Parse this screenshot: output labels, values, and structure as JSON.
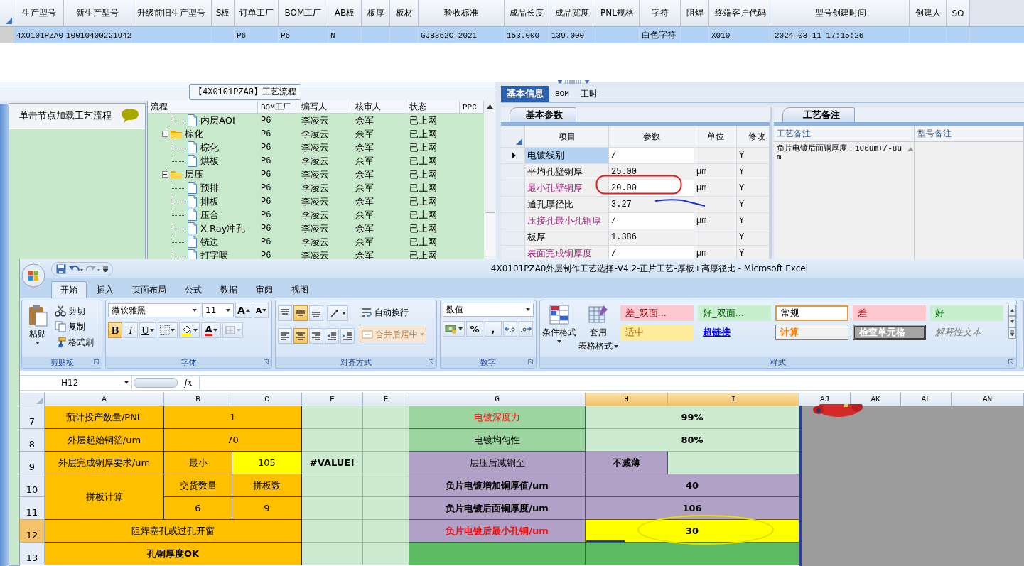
{
  "product_table": {
    "columns": [
      "生产型号",
      "新生产型号",
      "升级前旧生产型号",
      "S板",
      "订单工厂",
      "BOM工厂",
      "AB板",
      "板厚",
      "板材",
      "验收标准",
      "成品长度",
      "成品宽度",
      "PNL规格",
      "字符",
      "阻焊",
      "终端客户代码",
      "型号创建时间",
      "创建人",
      "SO"
    ],
    "rows": [
      {
        "selected": true,
        "cells": [
          "4X0101PZA0",
          "10010400221942",
          "",
          "",
          "P6",
          "P6",
          "N",
          "",
          "",
          "GJB362C-2021",
          "153.000",
          "139.000",
          "",
          "白色字符",
          "",
          "X010",
          "2024-03-11 17:15:26",
          "",
          ""
        ]
      }
    ]
  },
  "process_panel": {
    "title": "【4X0101PZA0】工艺流程",
    "hint": "单击节点加载工艺流程",
    "tree": {
      "columns": [
        "流程",
        "BOM工厂",
        "编写人",
        "核审人",
        "状态",
        "PPC"
      ],
      "continued_children": [
        {
          "kind": "file",
          "name": "内层AOI",
          "bom_factory": "P6",
          "author": "李凌云",
          "reviewer": "佘军",
          "status": "已上网"
        }
      ],
      "items": [
        {
          "kind": "folder",
          "name": "棕化",
          "expanded": true,
          "bom_factory": "P6",
          "author": "李凌云",
          "reviewer": "佘军",
          "status": "已上网",
          "children": [
            {
              "kind": "file",
              "name": "棕化",
              "bom_factory": "P6",
              "author": "李凌云",
              "reviewer": "佘军",
              "status": "已上网"
            },
            {
              "kind": "file",
              "name": "烘板",
              "bom_factory": "P6",
              "author": "李凌云",
              "reviewer": "佘军",
              "status": "已上网"
            }
          ]
        },
        {
          "kind": "folder",
          "name": "层压",
          "expanded": true,
          "bom_factory": "P6",
          "author": "李凌云",
          "reviewer": "佘军",
          "status": "已上网",
          "children": [
            {
              "kind": "file",
              "name": "预排",
              "bom_factory": "P6",
              "author": "李凌云",
              "reviewer": "佘军",
              "status": "已上网"
            },
            {
              "kind": "file",
              "name": "排板",
              "bom_factory": "P6",
              "author": "李凌云",
              "reviewer": "佘军",
              "status": "已上网"
            },
            {
              "kind": "file",
              "name": "压合",
              "bom_factory": "P6",
              "author": "李凌云",
              "reviewer": "佘军",
              "status": "已上网"
            },
            {
              "kind": "file",
              "name": "X-Ray冲孔",
              "bom_factory": "P6",
              "author": "李凌云",
              "reviewer": "佘军",
              "status": "已上网"
            },
            {
              "kind": "file",
              "name": "铣边",
              "bom_factory": "P6",
              "author": "李凌云",
              "reviewer": "佘军",
              "status": "已上网"
            },
            {
              "kind": "file",
              "name": "打字唛",
              "bom_factory": "P6",
              "author": "李凌云",
              "reviewer": "佘军",
              "status": "已上网"
            }
          ]
        }
      ]
    }
  },
  "detail_panel": {
    "tabs": [
      {
        "label": "基本信息",
        "selected": true
      },
      {
        "label": "BOM",
        "selected": false
      },
      {
        "label": "工时",
        "selected": false
      }
    ],
    "params": {
      "tab": "基本参数",
      "columns": [
        "项目",
        "参数",
        "单位",
        "修改"
      ],
      "rows": [
        {
          "item": "电镀线别",
          "value": "/",
          "modifiable": "Y",
          "required": false,
          "current": true
        },
        {
          "item": "平均孔壁铜厚",
          "value": "25.00",
          "unit": "µm",
          "modifiable": "Y",
          "required": false,
          "current": false
        },
        {
          "item": "最小孔壁铜厚",
          "value": "20.00",
          "unit": "µm",
          "modifiable": "Y",
          "required": true,
          "current": false
        },
        {
          "item": "通孔厚径比",
          "value": "3.27",
          "modifiable": "Y",
          "required": false,
          "current": false
        },
        {
          "item": "压接孔最小孔铜厚",
          "value": "/",
          "unit": "µm",
          "modifiable": "Y",
          "required": true,
          "current": false
        },
        {
          "item": "板厚",
          "value": "1.386",
          "modifiable": "Y",
          "required": false,
          "current": false
        },
        {
          "item": "表面完成铜厚度",
          "value": "/",
          "unit": "µm",
          "modifiable": "Y",
          "required": true,
          "current": false
        }
      ]
    },
    "notes": {
      "tab": "工艺备注",
      "columns": [
        "工艺备注",
        "型号备注"
      ],
      "process_note": "负片电镀后面铜厚度：106um+/-8um"
    }
  },
  "excel": {
    "title": "4X0101PZA0外层制作工艺选择-V4.2-正片工艺-厚板+高厚径比 - Microsoft Excel",
    "tabs": [
      {
        "label": "开始",
        "selected": true
      },
      {
        "label": "插入",
        "selected": false
      },
      {
        "label": "页面布局",
        "selected": false
      },
      {
        "label": "公式",
        "selected": false
      },
      {
        "label": "数据",
        "selected": false
      },
      {
        "label": "审阅",
        "selected": false
      },
      {
        "label": "视图",
        "selected": false
      }
    ],
    "ribbon": {
      "clipboard": {
        "label": "剪贴板",
        "paste": "粘贴",
        "cut": "剪切",
        "copy": "复制",
        "format_painter": "格式刷"
      },
      "font": {
        "label": "字体",
        "font_name": "微软雅黑",
        "font_size": "11",
        "grow_font": "A",
        "shrink_font": "A",
        "bold": "B",
        "italic": "I",
        "underline": "U",
        "font_color": "A"
      },
      "alignment": {
        "label": "对齐方式",
        "vertical": [
          {
            "kind": "top",
            "selected": false
          },
          {
            "kind": "middle",
            "selected": true
          },
          {
            "kind": "bottom",
            "selected": false
          }
        ],
        "horizontal": [
          {
            "kind": "left",
            "selected": false
          },
          {
            "kind": "center",
            "selected": true
          },
          {
            "kind": "right",
            "selected": false
          }
        ],
        "wrap_text": "自动换行",
        "merge_center": {
          "label": "合并后居中",
          "disabled": true
        }
      },
      "number": {
        "label": "数字",
        "format": "数值",
        "percent": "%",
        "comma": ","
      },
      "styles": {
        "label": "样式",
        "conditional_formatting": "条件格式",
        "table_format_line1": "套用",
        "table_format_line2": "表格格式",
        "gallery": [
          {
            "text": "差_双面...",
            "kind": "bad",
            "selected": false
          },
          {
            "text": "好_双面...",
            "kind": "good",
            "selected": false
          },
          {
            "text": "常规",
            "kind": "normal",
            "selected": true
          },
          {
            "text": "差",
            "kind": "bad",
            "selected": false
          },
          {
            "text": "好",
            "kind": "good",
            "selected": false
          },
          {
            "text": "适中",
            "kind": "neutral",
            "selected": false
          },
          {
            "text": "超链接",
            "kind": "link",
            "selected": false
          },
          {
            "text": "计算",
            "kind": "calc",
            "selected": false
          },
          {
            "text": "检查单元格",
            "kind": "check",
            "selected": false
          },
          {
            "text": "解释性文本",
            "kind": "explain",
            "selected": false
          }
        ]
      }
    },
    "name_box": "H12",
    "formula_label": "fx",
    "sheet": {
      "columns": [
        {
          "label": "A",
          "selected": false
        },
        {
          "label": "B",
          "selected": false
        },
        {
          "label": "C",
          "selected": false
        },
        {
          "label": "E",
          "selected": false
        },
        {
          "label": "F",
          "selected": false
        },
        {
          "label": "G",
          "selected": false
        },
        {
          "label": "H",
          "selected": true
        },
        {
          "label": "I",
          "selected": true
        },
        {
          "label": "AJ",
          "selected": false
        },
        {
          "label": "AK",
          "selected": false
        },
        {
          "label": "AL",
          "selected": false
        },
        {
          "label": "AN",
          "selected": false
        }
      ],
      "rows": [
        {
          "number": "7",
          "selected": false,
          "cells": [
            {
              "kind": "amber",
              "text": "预计投产数量/PNL",
              "bold": false,
              "warning": false
            },
            {
              "kind": "amber",
              "text": "1",
              "bold": false,
              "warning": false
            },
            {
              "kind": "merged"
            },
            {
              "kind": "mint"
            },
            {
              "kind": "mint"
            },
            {
              "kind": "green",
              "text": "电镀深度力",
              "bold": false,
              "warning": true
            },
            {
              "kind": "mint",
              "text": "99%",
              "bold": true,
              "warning": false
            },
            {
              "kind": "merged"
            }
          ]
        },
        {
          "number": "8",
          "selected": false,
          "cells": [
            {
              "kind": "amber",
              "text": "外层起始铜箔/um",
              "bold": false,
              "warning": false
            },
            {
              "kind": "amber",
              "text": "70",
              "bold": false,
              "warning": false
            },
            {
              "kind": "merged"
            },
            {
              "kind": "mint"
            },
            {
              "kind": "mint"
            },
            {
              "kind": "green",
              "text": "电镀均匀性",
              "bold": false,
              "warning": false
            },
            {
              "kind": "mint",
              "text": "80%",
              "bold": true,
              "warning": false
            },
            {
              "kind": "merged"
            }
          ]
        },
        {
          "number": "9",
          "selected": false,
          "cells": [
            {
              "kind": "amber",
              "text": "外层完成铜厚要求/um",
              "bold": false,
              "warning": false
            },
            {
              "kind": "amber",
              "text": "最小",
              "bold": false,
              "warning": false
            },
            {
              "kind": "yellow",
              "text": "105",
              "bold": false,
              "warning": false
            },
            {
              "kind": "mint",
              "text": "#VALUE!",
              "bold": true,
              "warning": false
            },
            {
              "kind": "mint"
            },
            {
              "kind": "lilac",
              "text": "层压后减铜至",
              "bold": false,
              "warning": false
            },
            {
              "kind": "lilac",
              "text": "不减薄",
              "bold": true,
              "warning": false
            },
            {
              "kind": "mint"
            }
          ]
        },
        {
          "number": "10",
          "selected": false,
          "cells": [
            {
              "kind": "amber",
              "text": "拼板计算",
              "bold": false,
              "warning": false
            },
            {
              "kind": "amber",
              "text": "交货数量",
              "bold": false,
              "warning": false
            },
            {
              "kind": "amber",
              "text": "拼板数",
              "bold": false,
              "warning": false
            },
            {
              "kind": "mint"
            },
            {
              "kind": "mint"
            },
            {
              "kind": "lilac",
              "text": "负片电镀增加铜厚值/um",
              "bold": true,
              "warning": false
            },
            {
              "kind": "lilac",
              "text": "40",
              "bold": true,
              "warning": false
            },
            {
              "kind": "merged"
            }
          ]
        },
        {
          "number": "11",
          "selected": false,
          "cells": [
            {
              "kind": "merged_up"
            },
            {
              "kind": "amber",
              "text": "6",
              "bold": false,
              "warning": false
            },
            {
              "kind": "amber",
              "text": "9",
              "bold": false,
              "warning": false
            },
            {
              "kind": "mint"
            },
            {
              "kind": "mint"
            },
            {
              "kind": "lilac",
              "text": "负片电镀后面铜厚度/um",
              "bold": true,
              "warning": false
            },
            {
              "kind": "lilac",
              "text": "106",
              "bold": true,
              "warning": false
            },
            {
              "kind": "merged"
            }
          ]
        },
        {
          "number": "12",
          "selected": true,
          "cells": [
            {
              "kind": "amber",
              "text": "阻焊塞孔或过孔开窗",
              "bold": false,
              "warning": false
            },
            {
              "kind": "merged"
            },
            {
              "kind": "merged"
            },
            {
              "kind": "mint"
            },
            {
              "kind": "mint"
            },
            {
              "kind": "lilac",
              "text": "负片电镀后最小孔铜/um",
              "bold": true,
              "warning": true
            },
            {
              "kind": "yellow",
              "text": "30",
              "bold": true,
              "warning": false
            },
            {
              "kind": "merged"
            }
          ]
        },
        {
          "number": "13",
          "selected": false,
          "cells": [
            {
              "kind": "amber",
              "text": "孔铜厚度OK",
              "bold": true,
              "warning": false
            },
            {
              "kind": "merged"
            },
            {
              "kind": "merged"
            },
            {
              "kind": "mint"
            },
            {
              "kind": "mint"
            },
            {
              "kind": "grass"
            },
            {
              "kind": "grass"
            },
            {
              "kind": "merged"
            }
          ]
        }
      ]
    }
  }
}
